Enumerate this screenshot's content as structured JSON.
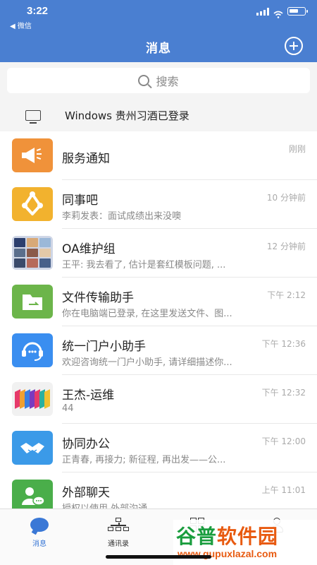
{
  "status_bar": {
    "time": "3:22",
    "back_label": "◀ 微信"
  },
  "header": {
    "title": "消息"
  },
  "search": {
    "placeholder": "搜索"
  },
  "login_notice": {
    "text": "Windows 贵州习酒已登录"
  },
  "conversations": [
    {
      "name": "服务通知",
      "preview": "",
      "time": "刚刚",
      "icon": "megaphone-icon"
    },
    {
      "name": "同事吧",
      "preview": "李莉发表：面试成绩出来没噢",
      "time": "10 分钟前",
      "icon": "share-icon"
    },
    {
      "name": "OA维护组",
      "preview": "王平: 我去看了, 估计是套红模板问题, ...",
      "time": "12 分钟前",
      "icon": "group-avatar"
    },
    {
      "name": "文件传输助手",
      "preview": "你在电脑端已登录, 在这里发送文件、图...",
      "time": "下午 2:12",
      "icon": "folder-icon"
    },
    {
      "name": "统一门户小助手",
      "preview": "欢迎咨询统一门户小助手, 请详细描述你...",
      "time": "下午 12:36",
      "icon": "headset-icon"
    },
    {
      "name": "王杰-运维",
      "preview": "44",
      "time": "下午 12:32",
      "icon": "stripes-avatar"
    },
    {
      "name": "协同办公",
      "preview": "正青春, 再接力; 新征程, 再出发——公...",
      "time": "下午 12:00",
      "icon": "handshake-icon"
    },
    {
      "name": "外部聊天",
      "preview": "授权以使用 外部沟通",
      "time": "上午 11:01",
      "icon": "chat-person-icon"
    }
  ],
  "tabs": [
    {
      "label": "消息",
      "active": true,
      "icon": "message-bubble-icon"
    },
    {
      "label": "通讯录",
      "active": false,
      "icon": "org-chart-icon"
    },
    {
      "label": "",
      "active": false,
      "icon": "grid-icon"
    },
    {
      "label": "",
      "active": false,
      "icon": "person-icon"
    }
  ],
  "watermark": {
    "logo_a": "谷普",
    "logo_b": "软件园",
    "url": "www.gupuxlazal.com"
  },
  "colors": {
    "header": "#4a7fd1",
    "accent": "#3a78d6"
  }
}
